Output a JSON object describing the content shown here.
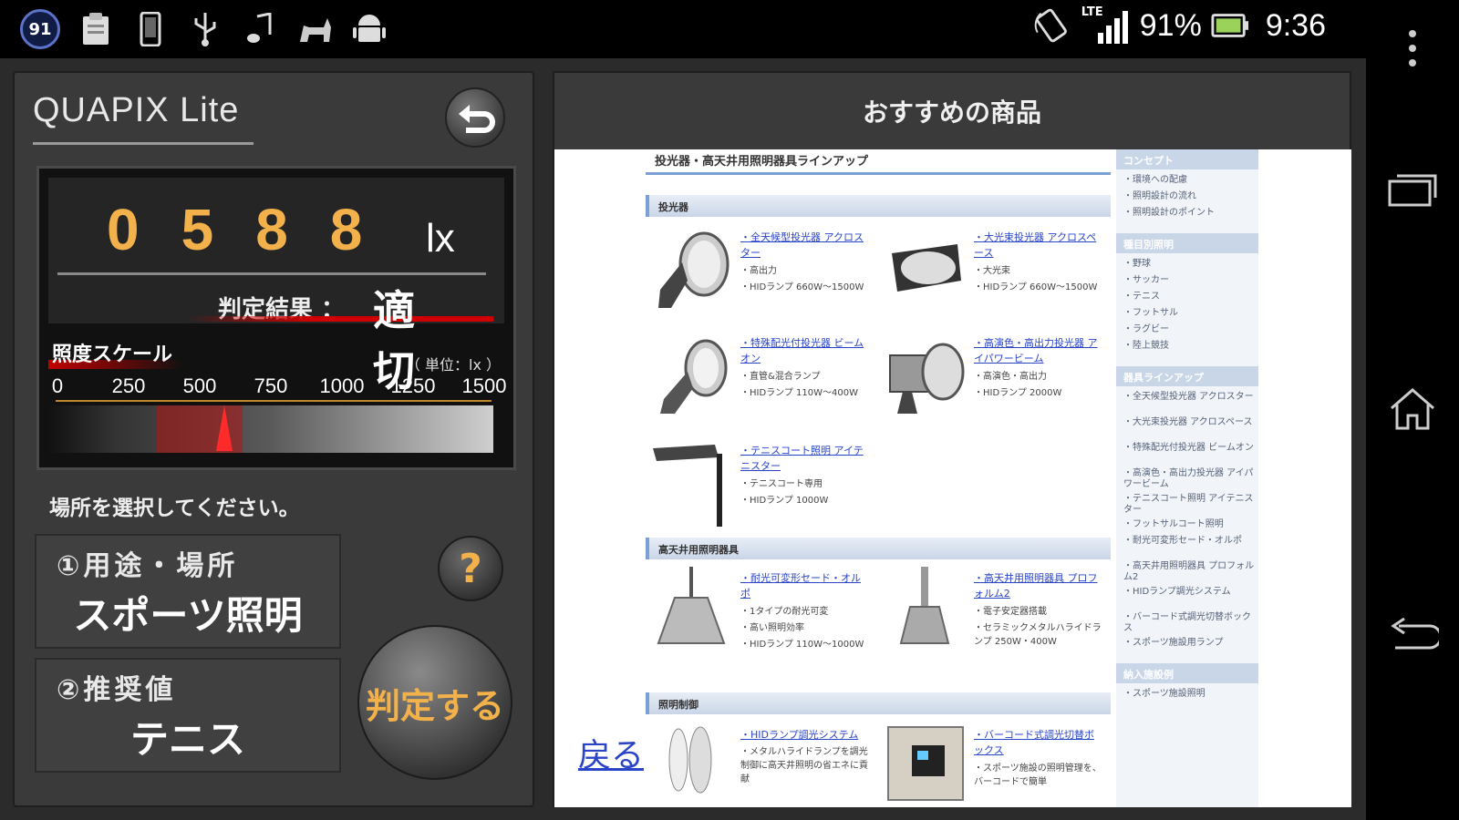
{
  "statusbar": {
    "notification_count": "91",
    "network": "LTE",
    "battery": "91%",
    "time": "9:36",
    "icons": [
      "notification-badge",
      "clipboard-icon",
      "phone-icon",
      "usb-icon",
      "music-icon",
      "cat-icon",
      "android-icon"
    ]
  },
  "app": {
    "title": "QUAPIX Lite",
    "lux_digits": [
      "0",
      "5",
      "8",
      "8"
    ],
    "lux_unit": "lx",
    "result_label": "判定結果 ：",
    "result_value": "適 切",
    "scale_title": "照度スケール",
    "scale_unit": "（ 単位：lx ）",
    "scale_ticks": [
      "0",
      "250",
      "500",
      "750",
      "1000",
      "1250",
      "1500"
    ],
    "scale_max": 1500,
    "measured_lux": 588,
    "recommended_range": [
      350,
      650
    ],
    "select_prompt": "場所を選択してください。",
    "usage_label": "①用途・場所",
    "usage_value": "スポーツ照明",
    "recommended_label": "②推奨値",
    "recommended_value": "テニス",
    "help_label": "?",
    "judge_button": "判定する"
  },
  "webview": {
    "panel_title": "おすすめの商品",
    "page_heading": "投光器・高天井用照明器具ラインアップ",
    "sections": [
      "投光器",
      "高天井用照明器具",
      "照明制御"
    ],
    "products": [
      {
        "link": "・全天候型投光器 アクロスター",
        "specs": [
          "・高出力",
          "・HIDランプ 660W～1500W"
        ]
      },
      {
        "link": "・大光束投光器 アクロスペース",
        "specs": [
          "・大光束",
          "・HIDランプ 660W～1500W"
        ]
      },
      {
        "link": "・特殊配光付投光器 ビームオン",
        "specs": [
          "・直管&混合ランプ",
          "・HIDランプ 110W～400W"
        ]
      },
      {
        "link": "・高演色・高出力投光器 アイパワービーム",
        "specs": [
          "・高演色・高出力",
          "・HIDランプ 2000W"
        ]
      },
      {
        "link": "・テニスコート照明 アイテニスター",
        "specs": [
          "・テニスコート専用",
          "・HIDランプ 1000W"
        ]
      },
      {
        "link": "・耐光可変形セード・オルポ",
        "specs": [
          "・1タイプの耐光可変",
          "・高い照明効率",
          "・HIDランプ 110W～1000W"
        ]
      },
      {
        "link": "・高天井用照明器具 プロフォルム2",
        "specs": [
          "・電子安定器搭載",
          "・セラミックメタルハライドランプ 250W・400W"
        ]
      },
      {
        "link": "・HIDランプ調光システム",
        "specs": [
          "・メタルハライドランプを調光制御に高天井照明の省エネに貢献"
        ]
      },
      {
        "link": "・バーコード式調光切替ボックス",
        "specs": [
          "・スポーツ施設の照明管理を、バーコードで簡単"
        ]
      }
    ],
    "back_link": "戻る",
    "sidebar": [
      {
        "heading": "コンセプト",
        "items": [
          "・環境への配慮",
          "・照明設計の流れ",
          "・照明設計のポイント"
        ]
      },
      {
        "heading": "種目別照明",
        "items": [
          "・野球",
          "・サッカー",
          "・テニス",
          "・フットサル",
          "・ラグビー",
          "・陸上競技"
        ]
      },
      {
        "heading": "器具ラインアップ",
        "items": [
          "・全天候型投光器 アクロスター",
          "・大光束投光器 アクロスペース",
          "・特殊配光付投光器 ビームオン",
          "・高演色・高出力投光器 アイパワービーム",
          "・テニスコート照明 アイテニスター",
          "・フットサルコート照明",
          "・耐光可変形セード・オルポ",
          "・高天井用照明器具 プロフォルム2",
          "・HIDランプ調光システム",
          "・バーコード式調光切替ボックス",
          "・スポーツ施設用ランプ"
        ]
      },
      {
        "heading": "納入施設例",
        "items": [
          "・スポーツ施設照明"
        ]
      }
    ]
  }
}
